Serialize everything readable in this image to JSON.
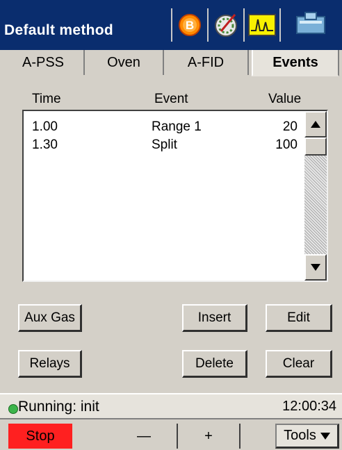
{
  "header": {
    "title": "Default method",
    "icons": [
      "badge-b-icon",
      "dial-needle-icon",
      "chromatogram-icon",
      "instrument-icon"
    ]
  },
  "tabs": [
    {
      "label": "A-PSS"
    },
    {
      "label": "Oven"
    },
    {
      "label": "A-FID"
    },
    {
      "label": "Events",
      "active": true
    }
  ],
  "events": {
    "columns": {
      "time": "Time",
      "event": "Event",
      "value": "Value"
    },
    "rows": [
      {
        "time": "1.00",
        "event": "Range 1",
        "value": "20"
      },
      {
        "time": "1.30",
        "event": "Split",
        "value": "100"
      }
    ]
  },
  "buttons": {
    "aux_gas": "Aux Gas",
    "insert": "Insert",
    "edit": "Edit",
    "relays": "Relays",
    "delete": "Delete",
    "clear": "Clear"
  },
  "status": {
    "text": "Running: init",
    "time": "12:00:34",
    "indicator_color": "#3cb44b"
  },
  "toolbar": {
    "stop": "Stop",
    "minus": "—",
    "plus": "+",
    "tools": "Tools"
  },
  "colors": {
    "titlebar": "#0a2d6e",
    "stop": "#ff2020"
  }
}
